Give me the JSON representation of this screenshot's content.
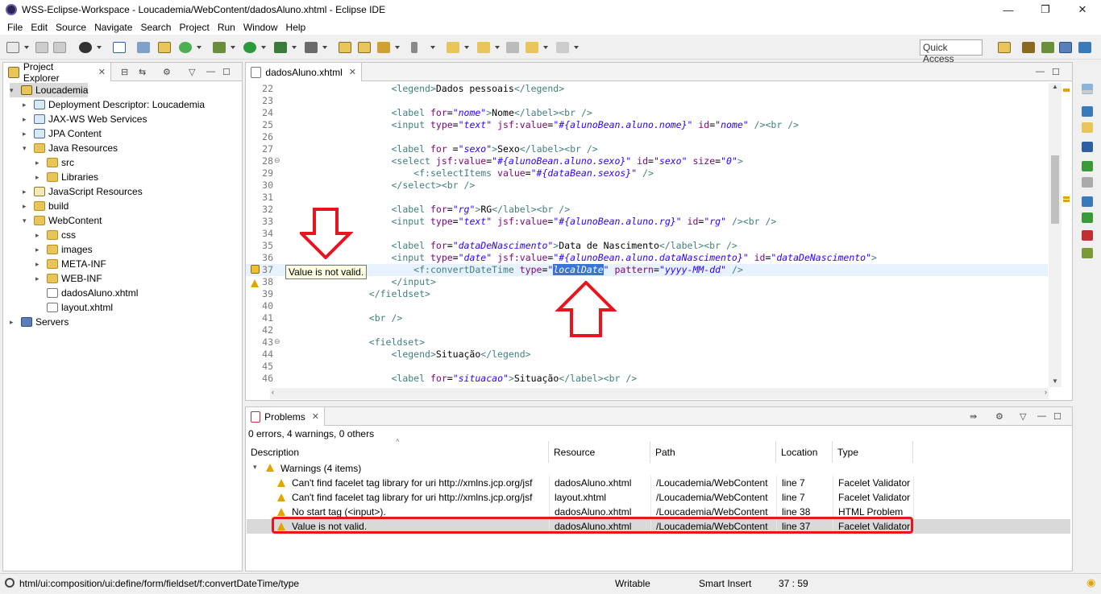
{
  "window": {
    "title": "WSS-Eclipse-Workspace - Loucademia/WebContent/dadosAluno.xhtml - Eclipse IDE",
    "minimize": "—",
    "restore": "❐",
    "close": "✕"
  },
  "menu": [
    "File",
    "Edit",
    "Source",
    "Navigate",
    "Search",
    "Project",
    "Run",
    "Window",
    "Help"
  ],
  "toolbar": {
    "quick_access": "Quick Access"
  },
  "explorer": {
    "tab_label": "Project Explorer",
    "items": [
      {
        "label": "Loucademia",
        "depth": 0,
        "arrow": "▾",
        "icon": "proj"
      },
      {
        "label": "Deployment Descriptor: Loucademia",
        "depth": 1,
        "arrow": "▸",
        "icon": "webicon"
      },
      {
        "label": "JAX-WS Web Services",
        "depth": 1,
        "arrow": "▸",
        "icon": "webicon"
      },
      {
        "label": "JPA Content",
        "depth": 1,
        "arrow": "▸",
        "icon": "webicon"
      },
      {
        "label": "Java Resources",
        "depth": 1,
        "arrow": "▾",
        "icon": "folder"
      },
      {
        "label": "src",
        "depth": 2,
        "arrow": "▸",
        "icon": "folder"
      },
      {
        "label": "Libraries",
        "depth": 2,
        "arrow": "▸",
        "icon": "folder"
      },
      {
        "label": "JavaScript Resources",
        "depth": 1,
        "arrow": "▸",
        "icon": "jsicon"
      },
      {
        "label": "build",
        "depth": 1,
        "arrow": "▸",
        "icon": "folder"
      },
      {
        "label": "WebContent",
        "depth": 1,
        "arrow": "▾",
        "icon": "folder"
      },
      {
        "label": "css",
        "depth": 2,
        "arrow": "▸",
        "icon": "folder"
      },
      {
        "label": "images",
        "depth": 2,
        "arrow": "▸",
        "icon": "folder"
      },
      {
        "label": "META-INF",
        "depth": 2,
        "arrow": "▸",
        "icon": "folder"
      },
      {
        "label": "WEB-INF",
        "depth": 2,
        "arrow": "▸",
        "icon": "folder"
      },
      {
        "label": "dadosAluno.xhtml",
        "depth": 2,
        "arrow": "",
        "icon": "xfile"
      },
      {
        "label": "layout.xhtml",
        "depth": 2,
        "arrow": "",
        "icon": "xfile"
      },
      {
        "label": "Servers",
        "depth": 0,
        "arrow": "▸",
        "icon": "srv"
      }
    ]
  },
  "editor": {
    "tab_label": "dadosAluno.xhtml",
    "tooltip": "Value is not valid.",
    "lines": [
      {
        "n": "22",
        "html": "                    <span class='tag'>&lt;legend&gt;</span><span class='txt'>Dados pessoais</span><span class='tag'>&lt;/legend&gt;</span>"
      },
      {
        "n": "23",
        "html": ""
      },
      {
        "n": "24",
        "html": "                    <span class='tag'>&lt;label</span> <span class='att'>for</span>=<span class='val'>\"nome\"</span><span class='tag'>&gt;</span><span class='txt'>Nome</span><span class='tag'>&lt;/label&gt;&lt;br /&gt;</span>"
      },
      {
        "n": "25",
        "html": "                    <span class='tag'>&lt;input</span> <span class='att'>type</span>=<span class='val'>\"text\"</span> <span class='att'>jsf:value</span>=<span class='val'>\"#{alunoBean.aluno.nome}\"</span> <span class='att'>id</span>=<span class='val'>\"nome\"</span> <span class='tag'>/&gt;&lt;br /&gt;</span>"
      },
      {
        "n": "26",
        "html": ""
      },
      {
        "n": "27",
        "html": "                    <span class='tag'>&lt;label</span> <span class='att'>for</span> =<span class='val'>\"sexo\"</span><span class='tag'>&gt;</span><span class='txt'>Sexo</span><span class='tag'>&lt;/label&gt;&lt;br /&gt;</span>"
      },
      {
        "n": "28",
        "html": "                    <span class='tag'>&lt;select</span> <span class='att'>jsf:value</span>=<span class='val'>\"#{alunoBean.aluno.sexo}\"</span> <span class='att'>id</span>=<span class='val'>\"sexo\"</span> <span class='att'>size</span>=<span class='val'>\"0\"</span><span class='tag'>&gt;</span>"
      },
      {
        "n": "29",
        "html": "                        <span class='tag'>&lt;f:selectItems</span> <span class='att'>value</span>=<span class='val'>\"#{dataBean.sexos}\"</span> <span class='tag'>/&gt;</span>"
      },
      {
        "n": "30",
        "html": "                    <span class='tag'>&lt;/select&gt;&lt;br /&gt;</span>"
      },
      {
        "n": "31",
        "html": ""
      },
      {
        "n": "32",
        "html": "                    <span class='tag'>&lt;label</span> <span class='att'>for</span>=<span class='val'>\"rg\"</span><span class='tag'>&gt;</span><span class='txt'>RG</span><span class='tag'>&lt;/label&gt;&lt;br /&gt;</span>"
      },
      {
        "n": "33",
        "html": "                    <span class='tag'>&lt;input</span> <span class='att'>type</span>=<span class='val'>\"text\"</span> <span class='att'>jsf:value</span>=<span class='val'>\"#{alunoBean.aluno.rg}\"</span> <span class='att'>id</span>=<span class='val'>\"rg\"</span> <span class='tag'>/&gt;&lt;br /&gt;</span>"
      },
      {
        "n": "34",
        "html": ""
      },
      {
        "n": "35",
        "html": "                    <span class='tag'>&lt;label</span> <span class='att'>for</span>=<span class='val'>\"dataDeNascimento\"</span><span class='tag'>&gt;</span><span class='txt'>Data de Nascimento</span><span class='tag'>&lt;/label&gt;&lt;br /&gt;</span>"
      },
      {
        "n": "36",
        "html": "                    <span class='tag'>&lt;input</span> <span class='att'>type</span>=<span class='val'>\"date\"</span> <span class='att'>jsf:value</span>=<span class='val'>\"#{alunoBean.aluno.dataNascimento}\"</span> <span class='att'>id</span>=<span class='val'>\"dataDeNascimento\"</span><span class='tag'>&gt;</span>"
      },
      {
        "n": "37",
        "html": "                        <span class='tag'>&lt;f:convertDateTime</span> <span class='att'>type</span>=<span class='val'>\"<span class='hl'>localDate</span>\"</span> <span class='att'>pattern</span>=<span class='val'>\"yyyy-MM-dd\"</span> <span class='tag'>/&gt;</span>"
      },
      {
        "n": "38",
        "html": "                    <span class='tag'>&lt;/input&gt;</span>"
      },
      {
        "n": "39",
        "html": "                <span class='tag'>&lt;/fieldset&gt;</span>"
      },
      {
        "n": "40",
        "html": ""
      },
      {
        "n": "41",
        "html": "                <span class='tag'>&lt;br /&gt;</span>"
      },
      {
        "n": "42",
        "html": ""
      },
      {
        "n": "43",
        "html": "                <span class='tag'>&lt;fieldset&gt;</span>"
      },
      {
        "n": "44",
        "html": "                    <span class='tag'>&lt;legend&gt;</span><span class='txt'>Situação</span><span class='tag'>&lt;/legend&gt;</span>"
      },
      {
        "n": "45",
        "html": ""
      },
      {
        "n": "46",
        "html": "                    <span class='tag'>&lt;label</span> <span class='att'>for</span>=<span class='val'>\"situacao\"</span><span class='tag'>&gt;</span><span class='txt'>Situação</span><span class='tag'>&lt;/label&gt;&lt;br /&gt;</span>"
      }
    ]
  },
  "problems": {
    "tab_label": "Problems",
    "summary": "0 errors, 4 warnings, 0 others",
    "columns": [
      "Description",
      "Resource",
      "Path",
      "Location",
      "Type"
    ],
    "group": "Warnings (4 items)",
    "rows": [
      [
        "Can't find facelet tag library for uri http://xmlns.jcp.org/jsf",
        "dadosAluno.xhtml",
        "/Loucademia/WebContent",
        "line 7",
        "Facelet Validator"
      ],
      [
        "Can't find facelet tag library for uri http://xmlns.jcp.org/jsf",
        "layout.xhtml",
        "/Loucademia/WebContent",
        "line 7",
        "Facelet Validator"
      ],
      [
        "No start tag (<input>).",
        "dadosAluno.xhtml",
        "/Loucademia/WebContent",
        "line 38",
        "HTML Problem"
      ],
      [
        "Value is not valid.",
        "dadosAluno.xhtml",
        "/Loucademia/WebContent",
        "line 37",
        "Facelet Validator"
      ]
    ]
  },
  "status": {
    "path": "html/ui:composition/ui:define/form/fieldset/f:convertDateTime/type",
    "writable": "Writable",
    "insert_mode": "Smart Insert",
    "position": "37 : 59"
  }
}
